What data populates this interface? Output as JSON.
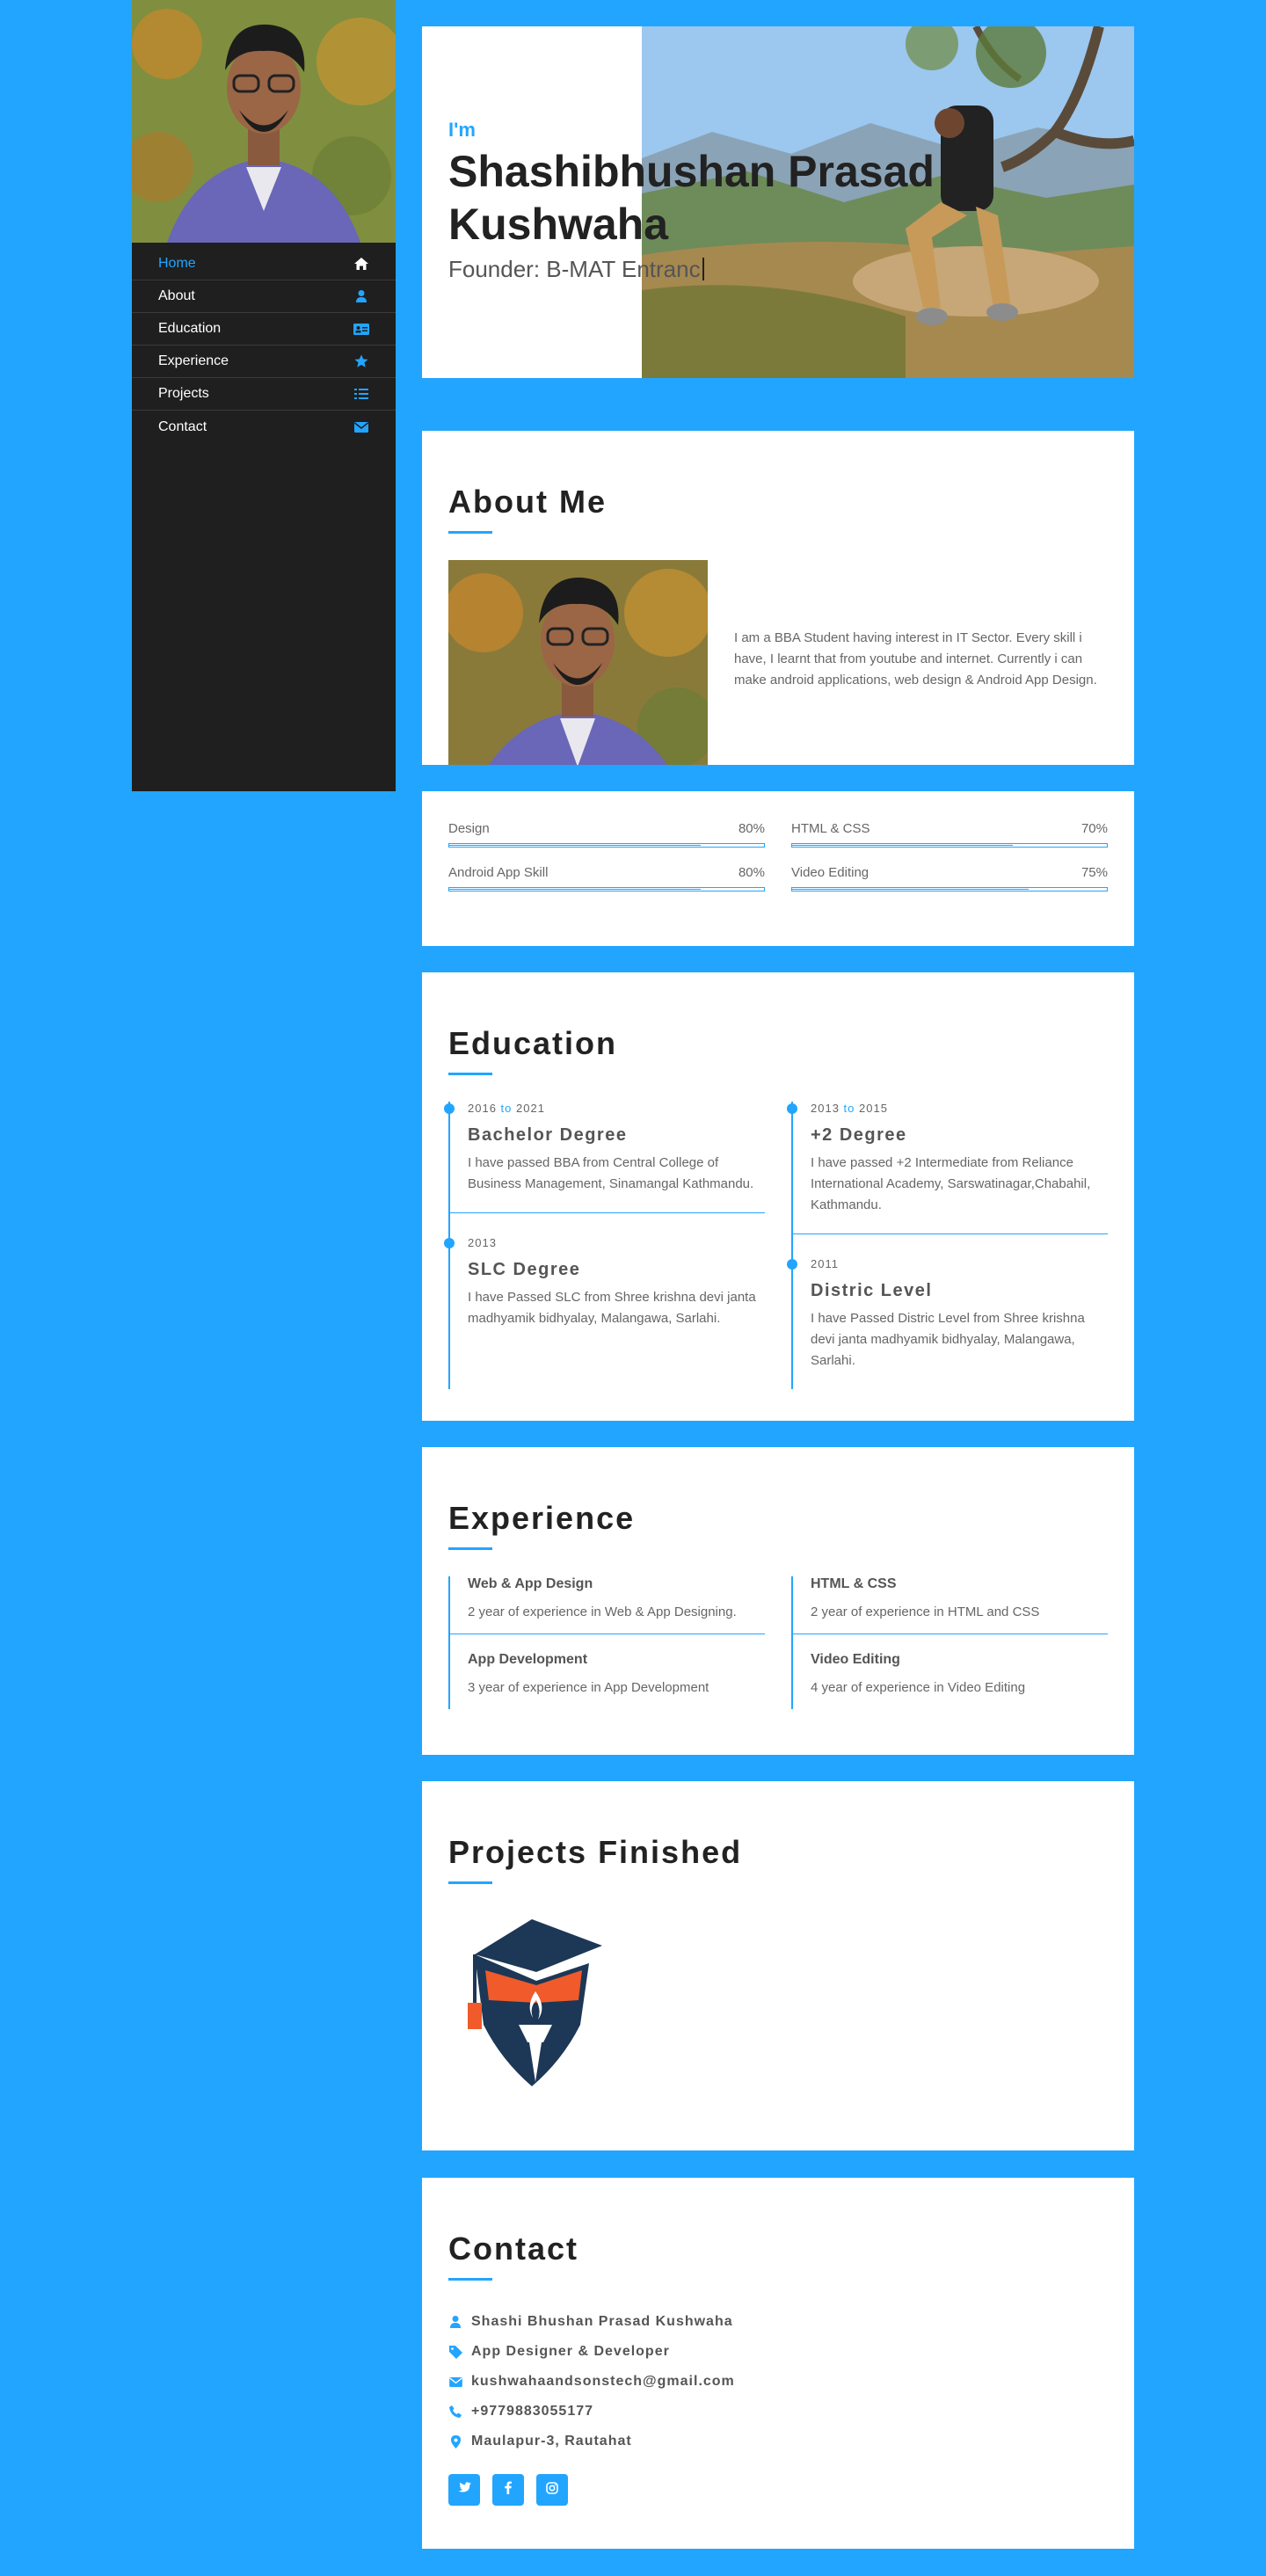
{
  "sidebar": {
    "nav": [
      {
        "label": "Home",
        "icon": "home-icon"
      },
      {
        "label": "About",
        "icon": "user-icon"
      },
      {
        "label": "Education",
        "icon": "id-card-icon"
      },
      {
        "label": "Experience",
        "icon": "star-icon"
      },
      {
        "label": "Projects",
        "icon": "list-icon"
      },
      {
        "label": "Contact",
        "icon": "envelope-icon"
      }
    ],
    "active_color": "#22a5ff"
  },
  "hero": {
    "prefix": "I'm",
    "name": "Shashibhushan Prasad Kushwaha",
    "subtitle": "Founder: B-MAT Entranc"
  },
  "about": {
    "title": "About Me",
    "text": "I am a BBA Student having interest in IT Sector. Every skill i have, I learnt that from youtube and internet. Currently i can make android applications, web design & Android App Design."
  },
  "skills": [
    {
      "name": "Design",
      "percent_label": "80%",
      "value": 0.8
    },
    {
      "name": "HTML & CSS",
      "percent_label": "70%",
      "value": 0.7
    },
    {
      "name": "Android App Skill",
      "percent_label": "80%",
      "value": 0.8
    },
    {
      "name": "Video Editing",
      "percent_label": "75%",
      "value": 0.75
    }
  ],
  "education": {
    "title": "Education",
    "left": [
      {
        "from": "2016",
        "to_word": "to",
        "to": "2021",
        "title": "Bachelor Degree",
        "desc": "I have passed BBA from Central College of Business Management, Sinamangal Kathmandu."
      },
      {
        "from": "2013",
        "to_word": "",
        "to": "",
        "title": "SLC Degree",
        "desc": "I have Passed SLC from Shree krishna devi janta madhyamik bidhyalay, Malangawa, Sarlahi."
      }
    ],
    "right": [
      {
        "from": "2013",
        "to_word": "to",
        "to": "2015",
        "title": "+2 Degree",
        "desc": "I have passed +2 Intermediate from Reliance International Academy, Sarswatinagar,Chabahil, Kathmandu."
      },
      {
        "from": "2011",
        "to_word": "",
        "to": "",
        "title": "Distric Level",
        "desc": "I have Passed Distric Level from Shree krishna devi janta madhyamik bidhyalay, Malangawa, Sarlahi."
      }
    ]
  },
  "experience": {
    "title": "Experience",
    "left": [
      {
        "title": "Web & App Design",
        "desc": "2 year of experience in Web & App Designing."
      },
      {
        "title": "App Development",
        "desc": "3 year of experience in App Development"
      }
    ],
    "right": [
      {
        "title": "HTML & CSS",
        "desc": "2 year of experience in HTML and CSS"
      },
      {
        "title": "Video Editing",
        "desc": "4 year of experience in Video Editing"
      }
    ]
  },
  "projects": {
    "title": "Projects Finished"
  },
  "contact": {
    "title": "Contact",
    "items": [
      {
        "icon": "user-icon",
        "text": "Shashi Bhushan Prasad Kushwaha"
      },
      {
        "icon": "tag-icon",
        "text": "App Designer & Developer"
      },
      {
        "icon": "envelope-icon",
        "text": "kushwahaandsonstech@gmail.com"
      },
      {
        "icon": "phone-icon",
        "text": "+9779883055177"
      },
      {
        "icon": "map-marker-icon",
        "text": "Maulapur-3, Rautahat"
      }
    ],
    "socials": [
      "twitter-icon",
      "facebook-icon",
      "instagram-icon"
    ]
  },
  "colors": {
    "accent": "#22a5ff",
    "sidebar": "#1f1f1f",
    "logo_navy": "#1d3756",
    "logo_orange": "#f15a2b"
  }
}
